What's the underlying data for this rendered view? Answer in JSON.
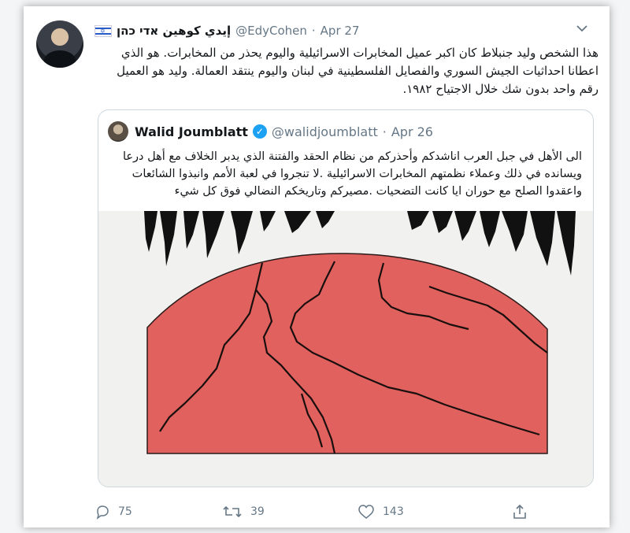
{
  "tweet": {
    "display_name": "إيدي كوهين אדי כהן",
    "flag_symbol": "✡",
    "handle": "@EdyCohen",
    "separator": "·",
    "date": "Apr 27",
    "text": "هذا الشخص وليد جنبلاط كان اكبر عميل المخابرات الاسرائيلية واليوم يحذر من المخابرات. هو الذي اعطانا احداثيات الجيش السوري والفصايل الفلسطينية في لبنان واليوم ينتقد العمالة. وليد هو العميل رقم واحد بدون شك خلال الاجتياح ١٩٨٢."
  },
  "quoted": {
    "display_name": "Walid Joumblatt",
    "verified_mark": "✓",
    "handle": "@walidjoumblatt",
    "separator": "·",
    "date": "Apr 26",
    "text": "الى الأهل في جبل العرب اناشدكم وأحذركم من نظام الحقد والفتنة الذي يدبر الخلاف  مع أهل درعا ويسانده في ذلك وعملاء نظمتهم  المخابرات الاسرائيلية .لا تنجروا في لعبة الأمم وانبذوا الشائعات واعقدوا الصلح مع حوران ايا كانت التضحيات .مصيركم وتاريخكم النضالي فوق كل شيء"
  },
  "actions": {
    "reply_count": "75",
    "retweet_count": "39",
    "like_count": "143"
  },
  "colors": {
    "accent": "#1da1f2",
    "muted": "#657786",
    "red_shape": "#e0615d"
  }
}
